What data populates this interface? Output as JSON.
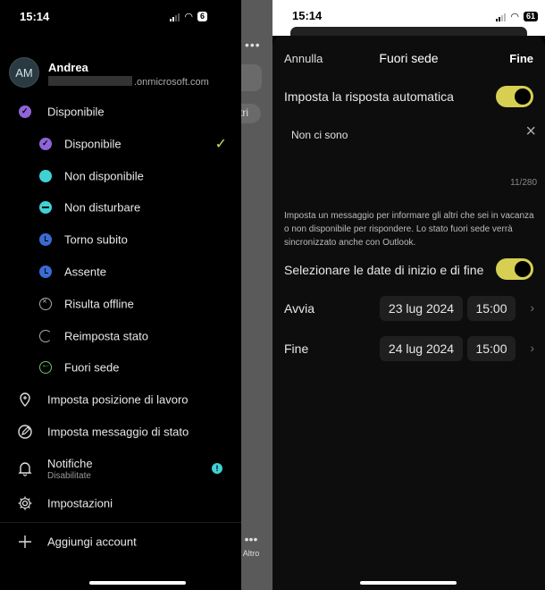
{
  "left": {
    "status": {
      "time": "15:14",
      "battery": "6"
    },
    "account": {
      "initials": "AM",
      "name": "Andrea",
      "email_suffix": ".onmicrosoft.com"
    },
    "status_header": "Disponibile",
    "status_options": [
      {
        "label": "Disponibile",
        "icon": "available-check-icon",
        "selected": true
      },
      {
        "label": "Non disponibile",
        "icon": "busy-dot-icon"
      },
      {
        "label": "Non disturbare",
        "icon": "do-not-disturb-icon"
      },
      {
        "label": "Torno subito",
        "icon": "clock-icon"
      },
      {
        "label": "Assente",
        "icon": "clock-icon"
      },
      {
        "label": "Risulta offline",
        "icon": "offline-icon"
      },
      {
        "label": "Reimposta stato",
        "icon": "reset-icon"
      },
      {
        "label": "Fuori sede",
        "icon": "out-of-office-icon"
      }
    ],
    "menu": {
      "work_location": "Imposta posizione di lavoro",
      "status_message": "Imposta messaggio di stato",
      "notifications": "Notifiche",
      "notifications_sub": "Disabilitate",
      "settings": "Impostazioni",
      "add_account": "Aggiungi account"
    },
    "background": {
      "chip_text": "tri",
      "more_label": "Altro"
    }
  },
  "right": {
    "status": {
      "time": "15:14",
      "battery": "61"
    },
    "header": {
      "cancel": "Annulla",
      "title": "Fuori sede",
      "done": "Fine"
    },
    "auto_reply_label": "Imposta la risposta automatica",
    "auto_reply_enabled": true,
    "message": "Non ci sono",
    "counter": "11/280",
    "help_text": "Imposta un messaggio per informare gli altri che sei in vacanza o non disponibile per rispondere. Lo stato fuori sede verrà sincronizzato anche con Outlook.",
    "dates_label": "Selezionare le date di inizio e di fine",
    "dates_enabled": true,
    "start": {
      "label": "Avvia",
      "date": "23 lug 2024",
      "time": "15:00"
    },
    "end": {
      "label": "Fine",
      "date": "24 lug 2024",
      "time": "15:00"
    }
  },
  "colors": {
    "accent_toggle": "#d6cf52",
    "available": "#8e66d8",
    "teal": "#40d1d6",
    "away": "#3a6bd3",
    "ooo": "#6bc36b"
  }
}
